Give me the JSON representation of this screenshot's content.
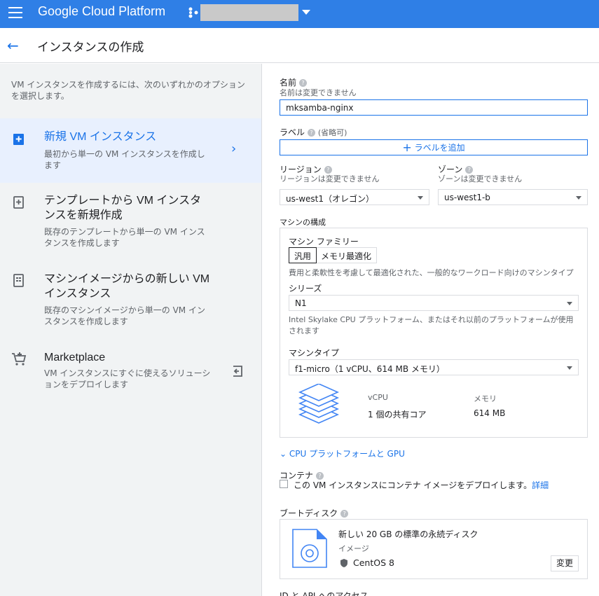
{
  "topbar": {
    "brand": "Google Cloud Platform",
    "menu_icon": "hamburger-icon",
    "project_icon": "project-hexagon-icon"
  },
  "header": {
    "title": "インスタンスの作成",
    "back_icon": "arrow-left-icon"
  },
  "left": {
    "intro": "VM インスタンスを作成するには、次のいずれかのオプションを選択します。",
    "options": [
      {
        "title": "新規 VM インスタンス",
        "desc": "最初から単一の VM インスタンスを作成します",
        "icon": "add-box-icon",
        "selected": true
      },
      {
        "title": "テンプレートから VM インスタンスを新規作成",
        "desc": "既存のテンプレートから単一の VM インスタンスを作成します",
        "icon": "template-add-icon",
        "selected": false
      },
      {
        "title": "マシンイメージからの新しい VM インスタンス",
        "desc": "既存のマシンイメージから単一の VM インスタンスを作成します",
        "icon": "machine-image-icon",
        "selected": false
      },
      {
        "title": "Marketplace",
        "desc": "VM インスタンスにすぐに使えるソリューションをデプロイします",
        "icon": "cart-icon",
        "selected": false
      }
    ]
  },
  "form": {
    "name_label": "名前",
    "name_sub": "名前は変更できません",
    "name_value": "mksamba-nginx",
    "labels_label": "ラベル",
    "labels_optional": "(省略可)",
    "add_label_button": "ラベルを追加",
    "region_label": "リージョン",
    "region_sub": "リージョンは変更できません",
    "region_value": "us-west1（オレゴン）",
    "zone_label": "ゾーン",
    "zone_sub": "ゾーンは変更できません",
    "zone_value": "us-west1-b",
    "machine_config_label": "マシンの構成",
    "family_label": "マシン ファミリー",
    "family_tabs": [
      "汎用",
      "メモリ最適化"
    ],
    "family_desc": "費用と柔軟性を考慮して最適化された、一般的なワークロード向けのマシンタイプ",
    "series_label": "シリーズ",
    "series_value": "N1",
    "series_desc": "Intel Skylake CPU プラットフォーム、またはそれ以前のプラットフォームが使用されます",
    "machine_type_label": "マシンタイプ",
    "machine_type_value": "f1-micro（1 vCPU、614 MB メモリ）",
    "vcpu_label": "vCPU",
    "vcpu_value": "1 個の共有コア",
    "memory_label": "メモリ",
    "memory_value": "614 MB",
    "cpu_gpu_link": "CPU プラットフォームと GPU",
    "container_label": "コンテナ",
    "container_checkbox": "この VM インスタンスにコンテナ イメージをデプロイします。",
    "container_link": "詳細",
    "boot_disk_label": "ブートディスク",
    "boot_disk_title": "新しい 20 GB の標準の永続ディスク",
    "image_label": "イメージ",
    "image_value": "CentOS 8",
    "change_button": "変更",
    "identity_label": "ID と API へのアクセス"
  }
}
